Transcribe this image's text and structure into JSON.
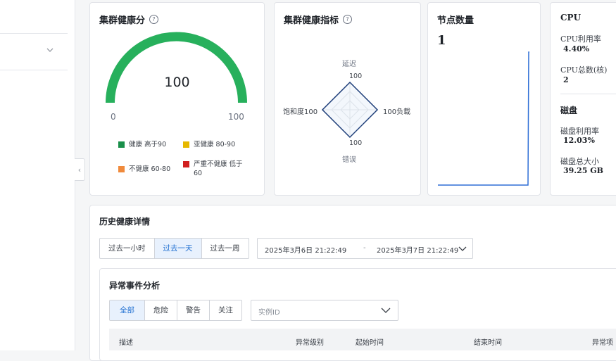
{
  "health_score": {
    "title": "集群健康分",
    "score": "100",
    "score_value": 100,
    "min": "0",
    "max": "100",
    "legend": [
      {
        "label": "健康 高于90",
        "color": "#1a8f4a"
      },
      {
        "label": "亚健康 80-90",
        "color": "#e6b800"
      },
      {
        "label": "不健康 60-80",
        "color": "#f08a3c"
      },
      {
        "label": "严重不健康 低于60",
        "color": "#d12020"
      }
    ],
    "gauge_color": "#27b05c"
  },
  "health_indicators": {
    "title": "集群健康指标",
    "axes": [
      {
        "name": "延迟",
        "value": "100"
      },
      {
        "name": "负载",
        "value": "100"
      },
      {
        "name": "错误",
        "value": "100"
      },
      {
        "name": "饱和度",
        "value": "100"
      }
    ]
  },
  "nodes": {
    "title": "节点数量",
    "value": "1",
    "line_color": "#2f6fd6"
  },
  "cpu": {
    "title": "CPU",
    "usage_label": "CPU利用率",
    "usage_value": "4.40%",
    "cores_label": "CPU总数(核)",
    "cores_value": "2"
  },
  "disk": {
    "title": "磁盘",
    "usage_label": "磁盘利用率",
    "usage_value": "12.03%",
    "total_label": "磁盘总大小",
    "total_value": "39.25 GB"
  },
  "history": {
    "title": "历史健康详情",
    "ranges": [
      "过去一小时",
      "过去一天",
      "过去一周"
    ],
    "active_range": "过去一天",
    "start": "2025年3月6日 21:22:49",
    "separator": "-",
    "end": "2025年3月7日 21:22:49"
  },
  "events": {
    "title": "异常事件分析",
    "filters": [
      "全部",
      "危险",
      "警告",
      "关注"
    ],
    "active_filter": "全部",
    "instance_placeholder": "实例ID",
    "columns": [
      "描述",
      "异常级别",
      "起始时间",
      "结束时间",
      "异常项"
    ]
  },
  "accent": "#1f6fd1"
}
